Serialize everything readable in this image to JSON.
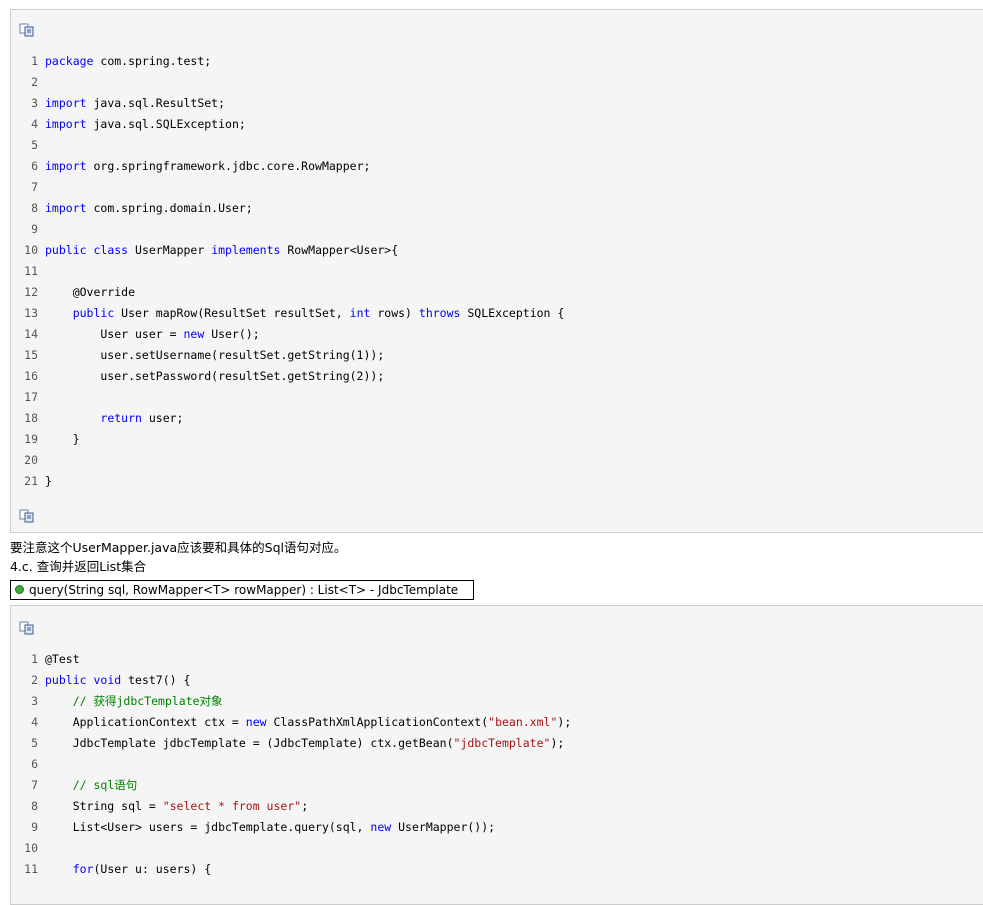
{
  "blocks": [
    {
      "lines": [
        {
          "n": "1",
          "t": [
            [
              "kw",
              "package"
            ],
            [
              "p",
              " com.spring.test;"
            ]
          ]
        },
        {
          "n": "2",
          "t": []
        },
        {
          "n": "3",
          "t": [
            [
              "kw",
              "import"
            ],
            [
              "p",
              " java.sql.ResultSet;"
            ]
          ]
        },
        {
          "n": "4",
          "t": [
            [
              "kw",
              "import"
            ],
            [
              "p",
              " java.sql.SQLException;"
            ]
          ]
        },
        {
          "n": "5",
          "t": []
        },
        {
          "n": "6",
          "t": [
            [
              "kw",
              "import"
            ],
            [
              "p",
              " org.springframework.jdbc.core.RowMapper;"
            ]
          ]
        },
        {
          "n": "7",
          "t": []
        },
        {
          "n": "8",
          "t": [
            [
              "kw",
              "import"
            ],
            [
              "p",
              " com.spring.domain.User;"
            ]
          ]
        },
        {
          "n": "9",
          "t": []
        },
        {
          "n": "10",
          "t": [
            [
              "kw",
              "public"
            ],
            [
              "p",
              " "
            ],
            [
              "kw",
              "class"
            ],
            [
              "p",
              " UserMapper "
            ],
            [
              "kw",
              "implements"
            ],
            [
              "p",
              " RowMapper<User>{"
            ]
          ]
        },
        {
          "n": "11",
          "t": []
        },
        {
          "n": "12",
          "t": [
            [
              "p",
              "    @Override"
            ]
          ]
        },
        {
          "n": "13",
          "t": [
            [
              "p",
              "    "
            ],
            [
              "kw",
              "public"
            ],
            [
              "p",
              " User mapRow(ResultSet resultSet, "
            ],
            [
              "kw",
              "int"
            ],
            [
              "p",
              " rows) "
            ],
            [
              "kw",
              "throws"
            ],
            [
              "p",
              " SQLException {"
            ]
          ]
        },
        {
          "n": "14",
          "t": [
            [
              "p",
              "        User user = "
            ],
            [
              "kw",
              "new"
            ],
            [
              "p",
              " User();"
            ]
          ]
        },
        {
          "n": "15",
          "t": [
            [
              "p",
              "        user.setUsername(resultSet.getString(1));"
            ]
          ]
        },
        {
          "n": "16",
          "t": [
            [
              "p",
              "        user.setPassword(resultSet.getString(2));"
            ]
          ]
        },
        {
          "n": "17",
          "t": []
        },
        {
          "n": "18",
          "t": [
            [
              "p",
              "        "
            ],
            [
              "kw",
              "return"
            ],
            [
              "p",
              " user;"
            ]
          ]
        },
        {
          "n": "19",
          "t": [
            [
              "p",
              "    }"
            ]
          ]
        },
        {
          "n": "20",
          "t": []
        },
        {
          "n": "21",
          "t": [
            [
              "p",
              "}"
            ]
          ]
        }
      ]
    },
    {
      "lines": [
        {
          "n": "1",
          "t": [
            [
              "p",
              "@Test"
            ]
          ]
        },
        {
          "n": "2",
          "t": [
            [
              "kw",
              "public"
            ],
            [
              "p",
              " "
            ],
            [
              "kw",
              "void"
            ],
            [
              "p",
              " test7() {"
            ]
          ]
        },
        {
          "n": "3",
          "t": [
            [
              "p",
              "    "
            ],
            [
              "cm",
              "// 获得jdbcTemplate对象"
            ]
          ]
        },
        {
          "n": "4",
          "t": [
            [
              "p",
              "    ApplicationContext ctx = "
            ],
            [
              "kw",
              "new"
            ],
            [
              "p",
              " ClassPathXmlApplicationContext("
            ],
            [
              "str",
              "\"bean.xml\""
            ],
            [
              "p",
              ");"
            ]
          ]
        },
        {
          "n": "5",
          "t": [
            [
              "p",
              "    JdbcTemplate jdbcTemplate = (JdbcTemplate) ctx.getBean("
            ],
            [
              "str",
              "\"jdbcTemplate\""
            ],
            [
              "p",
              ");"
            ]
          ]
        },
        {
          "n": "6",
          "t": []
        },
        {
          "n": "7",
          "t": [
            [
              "p",
              "    "
            ],
            [
              "cm",
              "// sql语句"
            ]
          ]
        },
        {
          "n": "8",
          "t": [
            [
              "p",
              "    String sql = "
            ],
            [
              "str",
              "\"select * from user\""
            ],
            [
              "p",
              ";"
            ]
          ]
        },
        {
          "n": "9",
          "t": [
            [
              "p",
              "    List<User> users = jdbcTemplate.query(sql, "
            ],
            [
              "kw",
              "new"
            ],
            [
              "p",
              " UserMapper());"
            ]
          ]
        },
        {
          "n": "10",
          "t": []
        },
        {
          "n": "11",
          "t": [
            [
              "p",
              "    "
            ],
            [
              "kw",
              "for"
            ],
            [
              "p",
              "(User u: users) {"
            ]
          ]
        }
      ]
    }
  ],
  "note_text": "要注意这个UserMapper.java应该要和具体的Sql语句对应。",
  "section_heading": "4.c. 查询并返回List集合",
  "method_signature": "query(String sql, RowMapper<T> rowMapper) : List<T> - JdbcTemplate",
  "icons": {
    "copy": "copy-code-icon",
    "method": "public-method-icon"
  },
  "colors": {
    "keyword": "#0000ff",
    "string": "#a31515",
    "comment": "#008000",
    "box_bg": "#f5f5f5"
  }
}
